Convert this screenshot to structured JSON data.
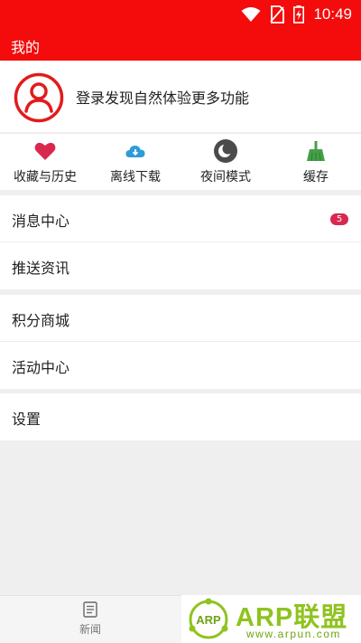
{
  "status_bar": {
    "time": "10:49"
  },
  "app_bar": {
    "title": "我的"
  },
  "profile": {
    "login_prompt": "登录发现自然体验更多功能"
  },
  "quick_actions": [
    {
      "label": "收藏与历史",
      "icon": "heart-icon"
    },
    {
      "label": "离线下载",
      "icon": "cloud-download-icon"
    },
    {
      "label": "夜间模式",
      "icon": "moon-icon"
    },
    {
      "label": "缓存",
      "icon": "broom-icon"
    }
  ],
  "menu_group_1": [
    {
      "label": "消息中心",
      "badge": "5"
    },
    {
      "label": "推送资讯"
    }
  ],
  "menu_group_2": [
    {
      "label": "积分商城"
    },
    {
      "label": "活动中心"
    }
  ],
  "menu_group_3": [
    {
      "label": "设置"
    }
  ],
  "bottom_nav": {
    "news_label": "新闻"
  },
  "watermark": {
    "logo_text": "ARP",
    "title": "ARP联盟",
    "url": "www.arpun.com"
  },
  "colors": {
    "brand_red": "#f40b0b",
    "badge_red": "#d9284f",
    "watermark_green": "#8fc31f"
  }
}
